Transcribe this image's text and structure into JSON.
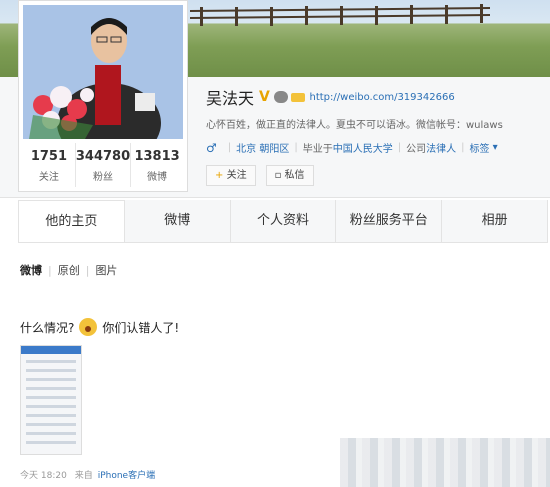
{
  "profile": {
    "name": "吴法天",
    "verified_mark": "V",
    "url": "http://weibo.com/319342666",
    "bio": "心怀百姓，做正直的法律人。夏虫不可以语冰。微信帐号：wulaws",
    "location": "北京 朝阳区",
    "education_prefix": "毕业于",
    "education_school": "中国人民大学",
    "company_prefix": "公司",
    "company": "法律人",
    "tag_label": "标签",
    "follow_label": "关注",
    "follow_plus": "+",
    "message_label": "私信"
  },
  "stats": [
    {
      "value": "1751",
      "label": "关注"
    },
    {
      "value": "344780",
      "label": "粉丝"
    },
    {
      "value": "13813",
      "label": "微博"
    }
  ],
  "tabs": [
    {
      "label": "他的主页"
    },
    {
      "label": "微博"
    },
    {
      "label": "个人资料"
    },
    {
      "label": "粉丝服务平台"
    },
    {
      "label": "相册"
    }
  ],
  "subtabs": [
    {
      "label": "微博"
    },
    {
      "label": "原创"
    },
    {
      "label": "图片"
    }
  ],
  "post": {
    "text_before": "什么情况?",
    "text_after": "你们认错人了!",
    "time": "今天 18:20",
    "source_prefix": "来自",
    "source": "iPhone客户端"
  },
  "icons": {
    "gender": "male-icon",
    "emoji": "surprised-emoji-icon"
  },
  "colors": {
    "link": "#2a6fb5",
    "verified": "#e8a400"
  }
}
